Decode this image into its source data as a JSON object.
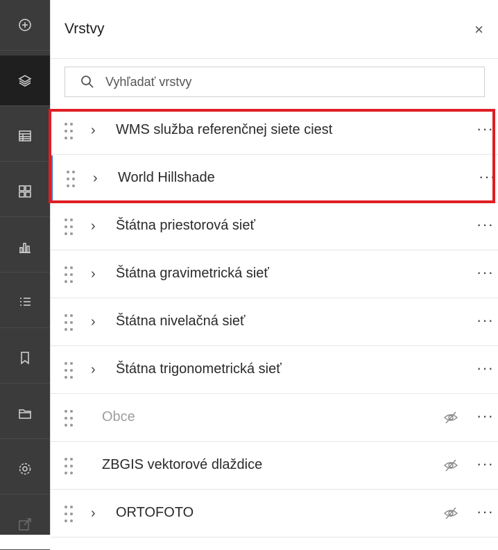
{
  "panel": {
    "title": "Vrstvy",
    "close": "×"
  },
  "search": {
    "placeholder": "Vyhľadať vrstvy"
  },
  "rail": {
    "buttons": [
      "add-icon",
      "layers-icon",
      "table-icon",
      "basemap-gallery-icon",
      "chart-icon",
      "legend-icon",
      "bookmark-icon",
      "folder-icon",
      "settings-icon",
      "share-icon"
    ],
    "active": "layers-icon"
  },
  "layers": [
    {
      "name": "WMS služba referenčnej siete ciest",
      "expandable": true,
      "hidden": false
    },
    {
      "name": "World Hillshade",
      "expandable": true,
      "hidden": false
    },
    {
      "name": "Štátna priestorová sieť",
      "expandable": true,
      "hidden": false
    },
    {
      "name": "Štátna gravimetrická sieť",
      "expandable": true,
      "hidden": false
    },
    {
      "name": "Štátna nivelačná sieť",
      "expandable": true,
      "hidden": false
    },
    {
      "name": "Štátna trigonometrická sieť",
      "expandable": true,
      "hidden": false
    },
    {
      "name": "Obce",
      "expandable": false,
      "hidden": true
    },
    {
      "name": "ZBGIS vektorové dlaždice",
      "expandable": false,
      "hidden": true
    },
    {
      "name": "ORTOFOTO",
      "expandable": true,
      "hidden": true
    }
  ],
  "row_symbols": {
    "chevron": "›",
    "more": "···"
  },
  "colors": {
    "rail": "#3b3b3b",
    "highlight": "#e01e24",
    "selected_marker": "#3b76c9"
  }
}
